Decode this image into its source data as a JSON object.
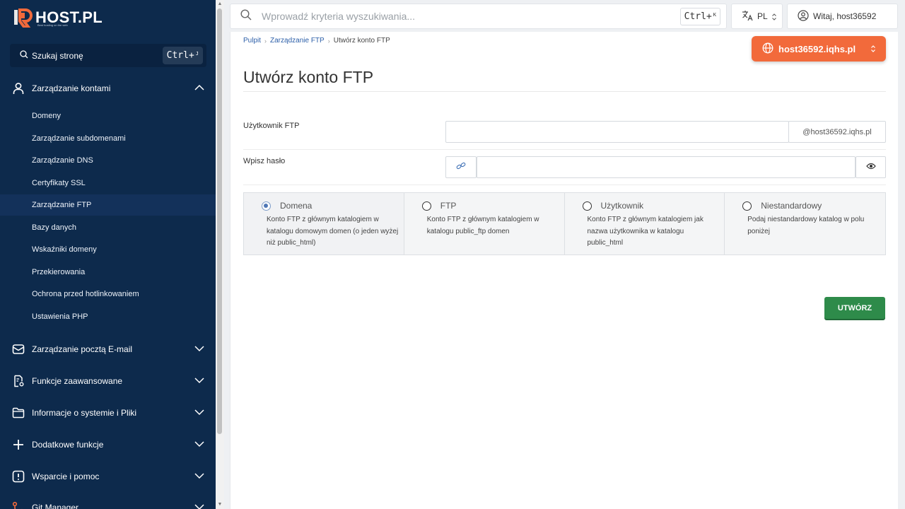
{
  "brand": {
    "name": "HOST.PL",
    "tagline": "Best hosting on the web"
  },
  "sidebar": {
    "search_label": "Szukaj stronę",
    "search_shortcut": "Ctrl+",
    "search_shortcut_key": "J",
    "groups": [
      {
        "label": "Zarządzanie kontami",
        "icon": "user-icon",
        "expanded": true
      },
      {
        "label": "Zarządzanie pocztą E-mail",
        "icon": "mail-icon"
      },
      {
        "label": "Funkcje zaawansowane",
        "icon": "settings-file-icon"
      },
      {
        "label": "Informacje o systemie i Pliki",
        "icon": "folder-icon"
      },
      {
        "label": "Dodatkowe funkcje",
        "icon": "plus-icon"
      },
      {
        "label": "Wsparcie i pomoc",
        "icon": "alert-icon"
      },
      {
        "label": "Git Manager",
        "icon": "git-icon"
      }
    ],
    "items": [
      {
        "label": "Domeny"
      },
      {
        "label": "Zarządzanie subdomenami"
      },
      {
        "label": "Zarządzanie DNS"
      },
      {
        "label": "Certyfikaty SSL"
      },
      {
        "label": "Zarządzanie FTP",
        "active": true
      },
      {
        "label": "Bazy danych"
      },
      {
        "label": "Wskaźniki domeny"
      },
      {
        "label": "Przekierowania"
      },
      {
        "label": "Ochrona przed hotlinkowaniem"
      },
      {
        "label": "Ustawienia PHP"
      }
    ]
  },
  "topbar": {
    "search_placeholder": "Wprowadź kryteria wyszukiwania...",
    "search_shortcut": "Ctrl+",
    "search_shortcut_key": "K",
    "language": "PL",
    "user_greeting": "Witaj, host36592"
  },
  "breadcrumb": [
    "Pulpit",
    "Zarządzanie FTP",
    "Utwórz konto FTP"
  ],
  "domain_selector": "host36592.iqhs.pl",
  "page_title": "Utwórz konto FTP",
  "form": {
    "user_label": "Użytkownik FTP",
    "user_value": "",
    "user_suffix": "@host36592.iqhs.pl",
    "password_label": "Wpisz hasło",
    "password_value": ""
  },
  "directory_options": [
    {
      "title": "Domena",
      "desc": "Konto FTP z głównym katalogiem w katalogu domowym domen (o jeden wyżej niż public_html)",
      "selected": true
    },
    {
      "title": "FTP",
      "desc": "Konto FTP z głównym katalogiem w katalogu public_ftp domen",
      "selected": false
    },
    {
      "title": "Użytkownik",
      "desc": "Konto FTP z głównym katalogiem jak nazwa użytkownika w katalogu public_html",
      "selected": false
    },
    {
      "title": "Niestandardowy",
      "desc": "Podaj niestandardowy katalog w polu poniżej",
      "selected": false
    }
  ],
  "create_button": "UTWÓRZ",
  "colors": {
    "sidebar_bg": "#0d2a4c",
    "accent_orange": "#f26a3b",
    "primary_green": "#2e8b4a",
    "link_blue": "#2b5ea8"
  }
}
